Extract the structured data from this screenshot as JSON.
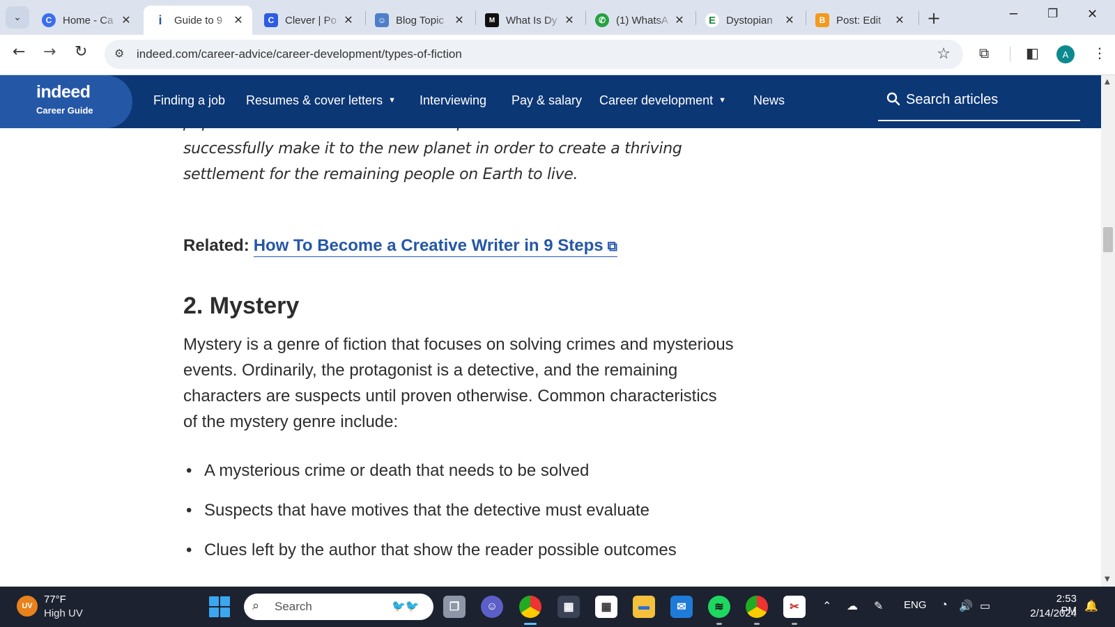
{
  "browser": {
    "tabs": [
      {
        "title": "Home - Ca",
        "favicon": "C",
        "favicon_color": "#3c6cf0",
        "active": false
      },
      {
        "title": "Guide to 9",
        "favicon": "i",
        "favicon_color": "#2557a7",
        "active": true
      },
      {
        "title": "Clever | Po",
        "favicon": "C",
        "favicon_color": "#2d5be3",
        "active": false
      },
      {
        "title": "Blog Topic",
        "favicon": "☺",
        "favicon_color": "#4e7fc8",
        "active": false
      },
      {
        "title": "What Is Dy",
        "favicon": "M",
        "favicon_color": "#111111",
        "active": false
      },
      {
        "title": "(1) WhatsA",
        "favicon": "✆",
        "favicon_color": "#25a244",
        "active": false
      },
      {
        "title": "Dystopian",
        "favicon": "E",
        "favicon_color": "#1f8a3a",
        "active": false
      },
      {
        "title": "Post: Edit",
        "favicon": "B",
        "favicon_color": "#f39a1e",
        "active": false
      }
    ],
    "new_tab_label": "+",
    "url": "indeed.com/career-advice/career-development/types-of-fiction",
    "profile_initial": "A"
  },
  "site": {
    "logo": "indeed",
    "logo_sub": "Career Guide",
    "nav": [
      {
        "label": "Finding a job",
        "dropdown": false
      },
      {
        "label": "Resumes & cover letters",
        "dropdown": true
      },
      {
        "label": "Interviewing",
        "dropdown": false
      },
      {
        "label": "Pay & salary",
        "dropdown": false
      },
      {
        "label": "Career development",
        "dropdown": true
      },
      {
        "label": "News",
        "dropdown": false
      }
    ],
    "search_label": "Search articles"
  },
  "article": {
    "italic_paragraph": "population back on Earth. It is now up to him and the rest of his crew to successfully make it to the new planet in order to create a thriving settlement for the remaining people on Earth to live.",
    "related_label": "Related:",
    "related_link": "How To Become a Creative Writer in 9 Steps",
    "heading": "2. Mystery",
    "paragraph": "Mystery is a genre of fiction that focuses on solving crimes and mysterious events. Ordinarily, the protagonist is a detective, and the remaining characters are suspects until proven otherwise. Common characteristics of the mystery genre include:",
    "bullets": [
      "A mysterious crime or death that needs to be solved",
      "Suspects that have motives that the detective must evaluate",
      "Clues left by the author that show the reader possible outcomes"
    ]
  },
  "taskbar": {
    "weather_badge": "UV",
    "temperature": "77°F",
    "condition": "High UV",
    "search_placeholder": "Search",
    "language": "ENG",
    "time": "2:53 PM",
    "date": "2/14/2024"
  },
  "colors": {
    "indeed_navy": "#0c3775",
    "indeed_blue": "#2557a7",
    "tabstrip": "#dde3ee",
    "taskbar": "#1c2230"
  }
}
